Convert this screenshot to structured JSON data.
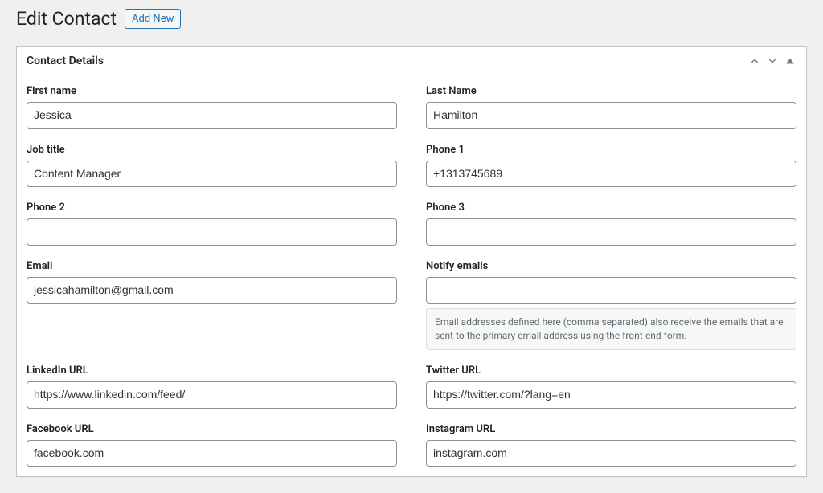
{
  "header": {
    "title": "Edit Contact",
    "add_new_label": "Add New"
  },
  "panel": {
    "title": "Contact Details"
  },
  "fields": {
    "first_name": {
      "label": "First name",
      "value": "Jessica"
    },
    "last_name": {
      "label": "Last Name",
      "value": "Hamilton"
    },
    "job_title": {
      "label": "Job title",
      "value": "Content Manager"
    },
    "phone1": {
      "label": "Phone 1",
      "value": "+1313745689"
    },
    "phone2": {
      "label": "Phone 2",
      "value": ""
    },
    "phone3": {
      "label": "Phone 3",
      "value": ""
    },
    "email": {
      "label": "Email",
      "value": "jessicahamilton@gmail.com"
    },
    "notify_emails": {
      "label": "Notify emails",
      "value": "",
      "description": "Email addresses defined here (comma separated) also receive the emails that are sent to the primary email address using the front-end form."
    },
    "linkedin": {
      "label": "LinkedIn URL",
      "value": "https://www.linkedin.com/feed/"
    },
    "twitter": {
      "label": "Twitter URL",
      "value": "https://twitter.com/?lang=en"
    },
    "facebook": {
      "label": "Facebook URL",
      "value": "facebook.com"
    },
    "instagram": {
      "label": "Instagram URL",
      "value": "instagram.com"
    }
  }
}
